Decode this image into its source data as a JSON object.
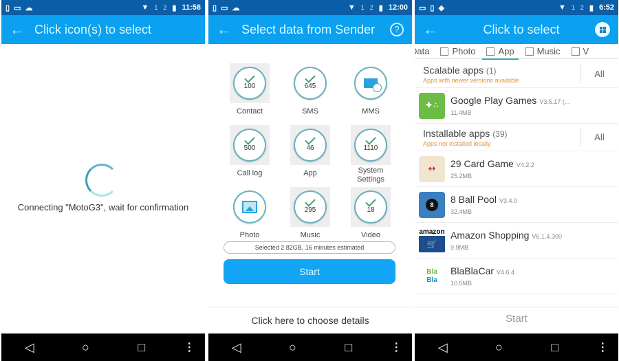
{
  "phone1": {
    "status": {
      "time": "11:58",
      "sim1": "1",
      "sim2": "2"
    },
    "appbar": {
      "back_icon": "arrow-left",
      "title": "Click icon(s) to select"
    },
    "connecting_text": "Connecting \"MotoG3\", wait for confirmation"
  },
  "phone2": {
    "status": {
      "time": "12:00",
      "sim1": "1",
      "sim2": "2"
    },
    "appbar": {
      "back_icon": "arrow-left",
      "title": "Select data from Sender",
      "help_icon": "?"
    },
    "categories": [
      {
        "label": "Contact",
        "count": "100",
        "selected": true
      },
      {
        "label": "SMS",
        "count": "645",
        "selected": false
      },
      {
        "label": "MMS",
        "count": "",
        "selected": false,
        "icon": "mms"
      },
      {
        "label": "Call log",
        "count": "500",
        "selected": true
      },
      {
        "label": "App",
        "count": "46",
        "selected": true
      },
      {
        "label": "System Settings",
        "count": "1110",
        "selected": true
      },
      {
        "label": "Photo",
        "count": "",
        "selected": false,
        "icon": "photo"
      },
      {
        "label": "Music",
        "count": "295",
        "selected": true
      },
      {
        "label": "Video",
        "count": "18",
        "selected": true
      }
    ],
    "selected_summary": "Selected 2.82GB, 16 minutes estimated",
    "start_label": "Start",
    "details_link": "Click here to choose details"
  },
  "phone3": {
    "status": {
      "time": "6:52",
      "sim1": "1",
      "sim2": "2"
    },
    "appbar": {
      "back_icon": "arrow-left",
      "title": "Click to select"
    },
    "tabs": [
      {
        "label": "Data",
        "checkbox": false,
        "active": false
      },
      {
        "label": "Photo",
        "checkbox": true,
        "active": false
      },
      {
        "label": "App",
        "checkbox": true,
        "active": true
      },
      {
        "label": "Music",
        "checkbox": true,
        "active": false
      },
      {
        "label": "V",
        "checkbox": true,
        "active": false
      }
    ],
    "sections": [
      {
        "title": "Scalable apps",
        "count": "(1)",
        "subtitle": "Apps with newer versions available",
        "all_label": "All"
      },
      {
        "title": "Installable apps",
        "count": "(39)",
        "subtitle": "Apps not installed locally",
        "all_label": "All"
      }
    ],
    "apps": [
      {
        "name": "Google Play Games",
        "version": "V3.5.17 (...",
        "size": "11.4MB"
      },
      {
        "name": "29 Card Game",
        "version": "V4.2.2",
        "size": "25.2MB"
      },
      {
        "name": "8 Ball Pool",
        "version": "V3.4.0",
        "size": "32.4MB"
      },
      {
        "name": "Amazon Shopping",
        "version": "V6.1.4.300",
        "size": "9.9MB"
      },
      {
        "name": "BlaBlaCar",
        "version": "V4.6.4",
        "size": "10.5MB"
      }
    ],
    "start_label": "Start"
  },
  "navbar": {
    "back": "◁",
    "home": "○",
    "recents": "□",
    "menu": "⋮"
  },
  "colors": {
    "appbar": "#0ba0f0",
    "statusbar": "#0b5ea8",
    "accent": "#12a4f5",
    "subtitle_orange": "#e0953c"
  }
}
